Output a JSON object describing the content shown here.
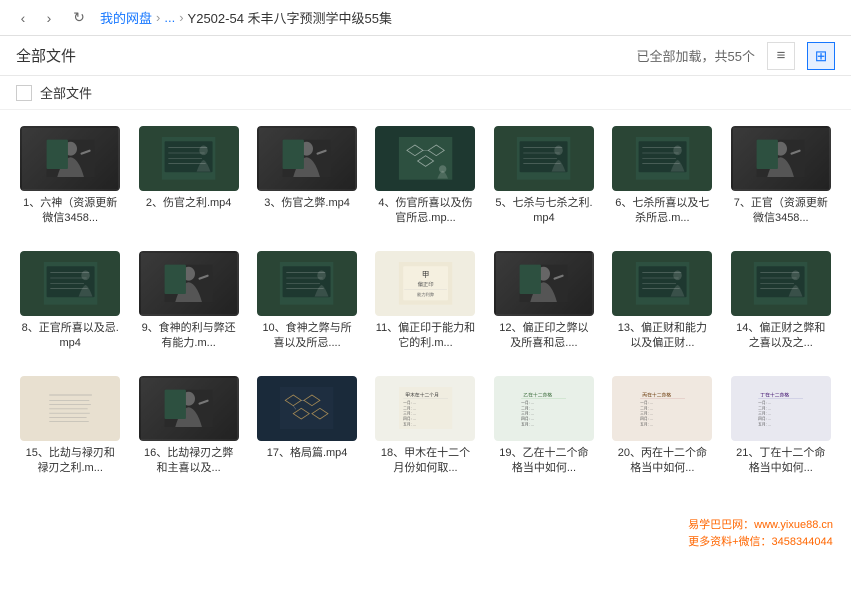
{
  "browser": {
    "back_label": "‹",
    "forward_label": "›",
    "refresh_label": "↻",
    "breadcrumb": {
      "home": "我的网盘",
      "sep1": "›",
      "ellipsis": "...",
      "sep2": "›",
      "current": "Y2502-54 禾丰八字预测学中级55集"
    }
  },
  "toolbar": {
    "title": "全部文件",
    "file_count": "已全部加载，共55个",
    "list_view_label": "≡",
    "grid_view_label": "⊞"
  },
  "select_all": {
    "label": "全部文件"
  },
  "watermark": {
    "line1": "易学巴巴网：www.yixue88.cn",
    "line2": "更多资料+微信：3458344044"
  },
  "files": [
    {
      "id": 1,
      "name": "1、六神（资源更新微信3458...",
      "thumb_type": "person",
      "has_red_label": false
    },
    {
      "id": 2,
      "name": "2、伤官之利.mp4",
      "thumb_type": "blackboard",
      "has_red_label": false
    },
    {
      "id": 3,
      "name": "3、伤官之弊.mp4",
      "thumb_type": "person",
      "has_red_label": false
    },
    {
      "id": 4,
      "name": "4、伤官所喜以及伤官所忌.mp...",
      "thumb_type": "diagram",
      "has_red_label": false
    },
    {
      "id": 5,
      "name": "5、七杀与七杀之利.mp4",
      "thumb_type": "blackboard",
      "has_red_label": false
    },
    {
      "id": 6,
      "name": "6、七杀所喜以及七杀所忌.m...",
      "thumb_type": "blackboard",
      "has_red_label": false
    },
    {
      "id": 7,
      "name": "7、正官（资源更新微信3458...",
      "thumb_type": "person",
      "has_red_label": false
    },
    {
      "id": 8,
      "name": "8、正官所喜以及忌.mp4",
      "thumb_type": "blackboard",
      "has_red_label": false
    },
    {
      "id": 9,
      "name": "9、食神的利与弊还有能力.m...",
      "thumb_type": "person",
      "has_red_label": false
    },
    {
      "id": 10,
      "name": "10、食神之弊与所喜以及所忌....",
      "thumb_type": "blackboard",
      "has_red_label": false
    },
    {
      "id": 11,
      "name": "11、偏正印于能力和它的利.m...",
      "thumb_type": "text",
      "has_red_label": false
    },
    {
      "id": 12,
      "name": "12、偏正印之弊以及所喜和忌....",
      "thumb_type": "person",
      "has_red_label": false
    },
    {
      "id": 13,
      "name": "13、偏正财和能力以及偏正财...",
      "thumb_type": "blackboard",
      "has_red_label": false
    },
    {
      "id": 14,
      "name": "14、偏正财之弊和之喜以及之...",
      "thumb_type": "blackboard",
      "has_red_label": false
    },
    {
      "id": 15,
      "name": "15、比劫与禄刃和禄刃之利.m...",
      "thumb_type": "text2",
      "has_red_label": false
    },
    {
      "id": 16,
      "name": "16、比劫禄刃之弊和主喜以及...",
      "thumb_type": "person",
      "has_red_label": false
    },
    {
      "id": 17,
      "name": "17、格局篇.mp4",
      "thumb_type": "diagram2",
      "has_red_label": false
    },
    {
      "id": 18,
      "name": "18、甲木在十二个月份如何取...",
      "thumb_type": "text3",
      "has_red_label": false
    },
    {
      "id": 19,
      "name": "19、乙在十二个命格当中如何...",
      "thumb_type": "text3b",
      "has_red_label": false
    },
    {
      "id": 20,
      "name": "20、丙在十二个命格当中如何...",
      "thumb_type": "text3c",
      "has_red_label": false
    },
    {
      "id": 21,
      "name": "21、丁在十二个命格当中如何...",
      "thumb_type": "text3d",
      "has_red_label": false
    }
  ]
}
